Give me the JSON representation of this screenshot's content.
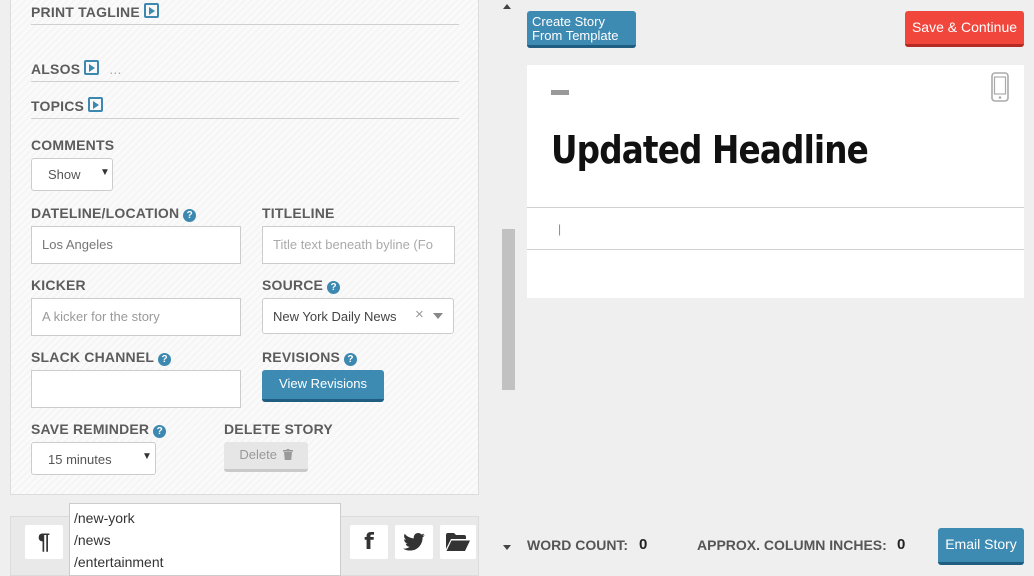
{
  "left_panel": {
    "print_tagline_label": "PRINT TAGLINE",
    "alsos_label": "ALSOS",
    "alsos_more": "...",
    "topics_label": "TOPICS",
    "comments_label": "COMMENTS",
    "comments_value": "Show",
    "dateline_label": "DATELINE/LOCATION",
    "dateline_value": "Los Angeles",
    "titleline_label": "TITLELINE",
    "titleline_placeholder": "Title text beneath byline (Fo",
    "kicker_label": "KICKER",
    "kicker_placeholder": "A kicker for the story",
    "source_label": "SOURCE",
    "source_value": "New York Daily News",
    "source_clear": "×",
    "slack_label": "SLACK CHANNEL",
    "slack_value": "",
    "revisions_label": "REVISIONS",
    "view_revisions_label": "View Revisions",
    "save_reminder_label": "SAVE REMINDER",
    "save_reminder_value": "15 minutes",
    "delete_story_label": "DELETE STORY",
    "delete_button_label": "Delete"
  },
  "dropdown": {
    "items": [
      "/new-york",
      "/news",
      "/entertainment"
    ]
  },
  "toolbar": {
    "paragraph_glyph": "¶",
    "facebook_glyph": "f"
  },
  "header": {
    "create_template_label_1": "Create Story",
    "create_template_label_2": "From Template",
    "save_continue_label": "Save & Continue"
  },
  "preview": {
    "headline": "Updated Headline",
    "body_cursor": "|"
  },
  "footer": {
    "word_count_label": "WORD COUNT:",
    "word_count_value": "0",
    "column_inches_label": "APPROX. COLUMN INCHES:",
    "column_inches_value": "0",
    "email_story_label": "Email Story"
  },
  "colors": {
    "accent_blue": "#3d8ab3",
    "save_red": "#f0463c"
  }
}
